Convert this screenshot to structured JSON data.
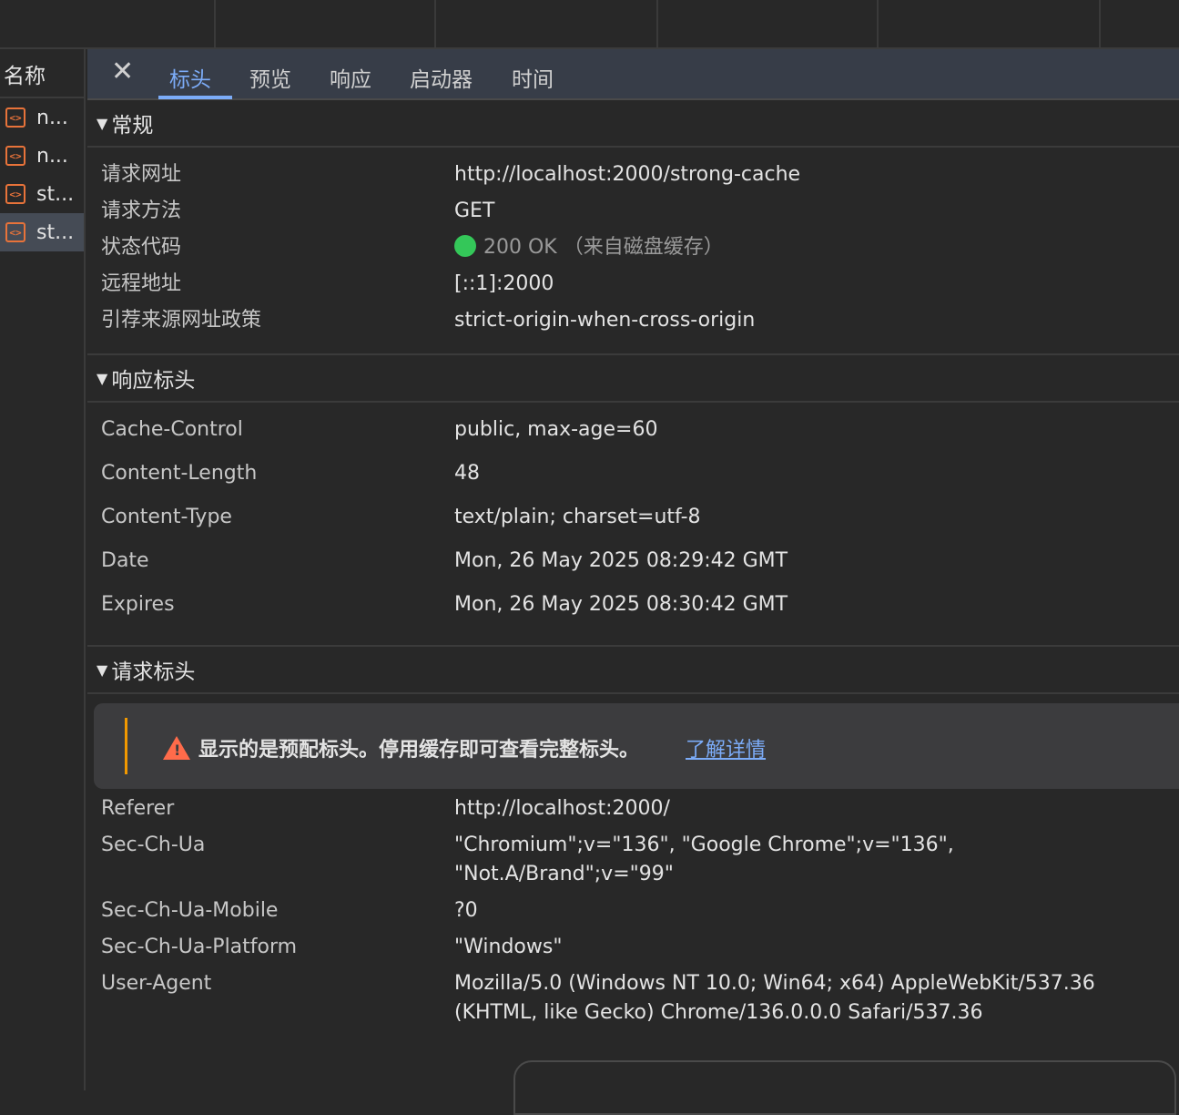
{
  "left": {
    "header": "名称",
    "requests": [
      {
        "name": "n...",
        "icon": "document-icon"
      },
      {
        "name": "n...",
        "icon": "document-icon"
      },
      {
        "name": "st...",
        "icon": "document-icon"
      },
      {
        "name": "st...",
        "icon": "document-icon"
      }
    ]
  },
  "tabs": {
    "close": "✕",
    "items": [
      "标头",
      "预览",
      "响应",
      "启动器",
      "时间"
    ]
  },
  "general": {
    "title": "常规",
    "rows": [
      {
        "k": "请求网址",
        "v": "http://localhost:2000/strong-cache"
      },
      {
        "k": "请求方法",
        "v": "GET"
      },
      {
        "k": "状态代码",
        "v": "200 OK （来自磁盘缓存）"
      },
      {
        "k": "远程地址",
        "v": "[::1]:2000"
      },
      {
        "k": "引荐来源网址政策",
        "v": "strict-origin-when-cross-origin"
      }
    ],
    "status_color": "#34c759"
  },
  "response": {
    "title": "响应标头",
    "rows": [
      {
        "k": "Cache-Control",
        "v": "public, max-age=60"
      },
      {
        "k": "Content-Length",
        "v": "48"
      },
      {
        "k": "Content-Type",
        "v": "text/plain; charset=utf-8"
      },
      {
        "k": "Date",
        "v": "Mon, 26 May 2025 08:29:42 GMT"
      },
      {
        "k": "Expires",
        "v": "Mon, 26 May 2025 08:30:42 GMT"
      }
    ]
  },
  "request": {
    "title": "请求标头",
    "warning": "显示的是预配标头。停用缓存即可查看完整标头。",
    "learn_more": "了解详情",
    "rows": [
      {
        "k": "Referer",
        "v": "http://localhost:2000/"
      },
      {
        "k": "Sec-Ch-Ua",
        "v": "\"Chromium\";v=\"136\", \"Google Chrome\";v=\"136\",",
        "v2": "\"Not.A/Brand\";v=\"99\""
      },
      {
        "k": "Sec-Ch-Ua-Mobile",
        "v": "?0"
      },
      {
        "k": "Sec-Ch-Ua-Platform",
        "v": "\"Windows\""
      },
      {
        "k": "User-Agent",
        "v": "Mozilla/5.0 (Windows NT 10.0; Win64; x64) AppleWebKit/537.36",
        "v2": "(KHTML, like Gecko) Chrome/136.0.0.0 Safari/537.36"
      }
    ]
  },
  "colors": {
    "accent": "#7cacf8",
    "warning": "#f29900",
    "request_icon": "#e8733a"
  }
}
